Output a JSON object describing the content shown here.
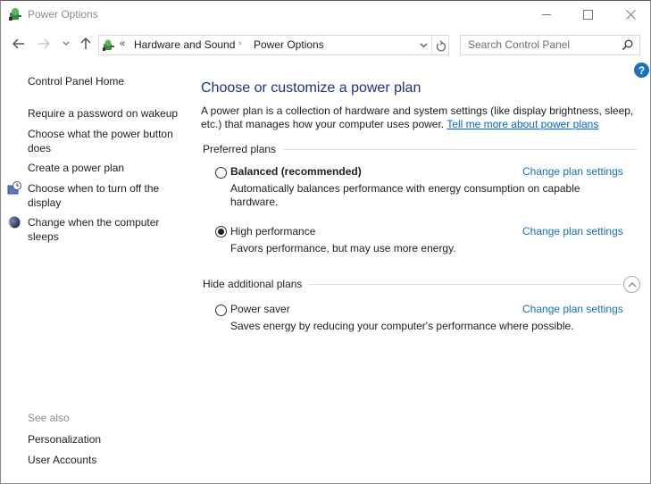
{
  "window": {
    "title": "Power Options",
    "controls": {
      "minimize": "minimize",
      "maximize": "maximize",
      "close": "close"
    }
  },
  "nav": {
    "back": "back-arrow",
    "forward": "forward-arrow",
    "recent": "recent-locations",
    "up": "up-arrow",
    "address": {
      "overflow": "«",
      "crumbs": [
        "Hardware and Sound",
        "Power Options"
      ],
      "separator": "›"
    },
    "search_placeholder": "Search Control Panel"
  },
  "help": "?",
  "sidebar": {
    "home": "Control Panel Home",
    "links": [
      {
        "label": "Require a password on wakeup",
        "icon": null
      },
      {
        "label": "Choose what the power button does",
        "icon": null
      },
      {
        "label": "Create a power plan",
        "icon": null
      },
      {
        "label": "Choose when to turn off the display",
        "icon": "monitor-clock-icon"
      },
      {
        "label": "Change when the computer sleeps",
        "icon": "moon-icon"
      }
    ],
    "see_also": {
      "title": "See also",
      "links": [
        "Personalization",
        "User Accounts"
      ]
    }
  },
  "main": {
    "heading": "Choose or customize a power plan",
    "description": "A power plan is a collection of hardware and system settings (like display brightness, sleep, etc.) that manages how your computer uses power.",
    "description_link": "Tell me more about power plans",
    "preferred_group": "Preferred plans",
    "additional_group": "Hide additional plans",
    "plans": [
      {
        "name": "Balanced (recommended)",
        "description": "Automatically balances performance with energy consumption on capable hardware.",
        "link": "Change plan settings",
        "selected": false,
        "bold": true
      },
      {
        "name": "High performance",
        "description": "Favors performance, but may use more energy.",
        "link": "Change plan settings",
        "selected": true,
        "bold": false
      },
      {
        "name": "Power saver",
        "description": "Saves energy by reducing your computer's performance where possible.",
        "link": "Change plan settings",
        "selected": false,
        "bold": false
      }
    ]
  },
  "colors": {
    "heading": "#1e3287",
    "link": "#1a6fb0",
    "underline_link": "#0066cc",
    "help_badge": "#1f6fbf"
  }
}
